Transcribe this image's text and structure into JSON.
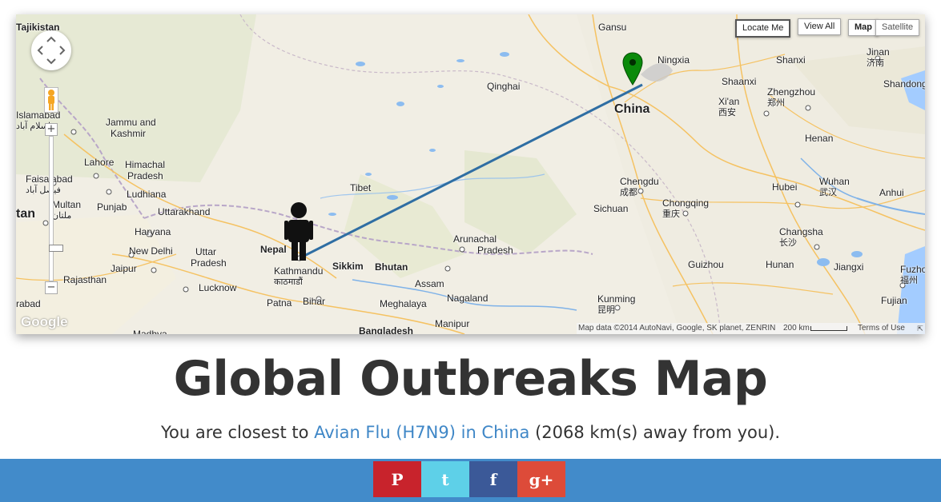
{
  "map": {
    "controls": {
      "locate_me": "Locate Me",
      "view_all": "View All",
      "map_type": "Map",
      "satellite_type": "Satellite",
      "zoom_in": "+",
      "zoom_out": "−"
    },
    "attribution": "Map data ©2014 AutoNavi, Google, SK planet, ZENRIN",
    "scale": "200 km",
    "terms": "Terms of Use",
    "logo": "Google",
    "user_icon": "person-marker-icon",
    "outbreak_icon": "green-pin-icon",
    "line_color": "#2f6ea3",
    "places": [
      {
        "name": "Tajikistan",
        "zh": ""
      },
      {
        "name": "Gansu",
        "zh": ""
      },
      {
        "name": "Ningxia",
        "zh": ""
      },
      {
        "name": "Shanxi",
        "zh": ""
      },
      {
        "name": "Jinan",
        "zh": "济南"
      },
      {
        "name": "Shandong",
        "zh": ""
      },
      {
        "name": "Qinghai",
        "zh": ""
      },
      {
        "name": "Shaanxi",
        "zh": ""
      },
      {
        "name": "Zhengzhou",
        "zh": "郑州"
      },
      {
        "name": "Xi'an",
        "zh": "西安"
      },
      {
        "name": "China",
        "zh": ""
      },
      {
        "name": "Islamabad",
        "zh": "اسلام آباد"
      },
      {
        "name": "Jammu and",
        "zh": ""
      },
      {
        "name": "Kashmir",
        "zh": ""
      },
      {
        "name": "Henan",
        "zh": ""
      },
      {
        "name": "Lahore",
        "zh": ""
      },
      {
        "name": "Himachal",
        "zh": ""
      },
      {
        "name": "Pradesh",
        "zh": ""
      },
      {
        "name": "Faisalabad",
        "zh": "فیصل آباد"
      },
      {
        "name": "Tibet",
        "zh": ""
      },
      {
        "name": "Chengdu",
        "zh": "成都"
      },
      {
        "name": "Hubei",
        "zh": ""
      },
      {
        "name": "Wuhan",
        "zh": "武汉"
      },
      {
        "name": "Anhui",
        "zh": ""
      },
      {
        "name": "Ludhiana",
        "zh": ""
      },
      {
        "name": "Chongqing",
        "zh": "重庆"
      },
      {
        "name": "Multan",
        "zh": "ملتان"
      },
      {
        "name": "Punjab",
        "zh": ""
      },
      {
        "name": "Sichuan",
        "zh": ""
      },
      {
        "name": "tan",
        "zh": ""
      },
      {
        "name": "Uttarakhand",
        "zh": ""
      },
      {
        "name": "Haryana",
        "zh": ""
      },
      {
        "name": "Arunachal",
        "zh": ""
      },
      {
        "name": "Pradesh",
        "zh": ""
      },
      {
        "name": "Changsha",
        "zh": "长沙"
      },
      {
        "name": "New Delhi",
        "zh": ""
      },
      {
        "name": "Uttar",
        "zh": ""
      },
      {
        "name": "Pradesh",
        "zh": ""
      },
      {
        "name": "Nepal",
        "zh": ""
      },
      {
        "name": "Jaipur",
        "zh": ""
      },
      {
        "name": "Kathmandu",
        "zh": "काठमाडौं"
      },
      {
        "name": "Sikkim",
        "zh": ""
      },
      {
        "name": "Bhutan",
        "zh": ""
      },
      {
        "name": "Guizhou",
        "zh": ""
      },
      {
        "name": "Hunan",
        "zh": ""
      },
      {
        "name": "Jiangxi",
        "zh": ""
      },
      {
        "name": "Fuzhou",
        "zh": "福州"
      },
      {
        "name": "Rajasthan",
        "zh": ""
      },
      {
        "name": "Lucknow",
        "zh": ""
      },
      {
        "name": "Assam",
        "zh": ""
      },
      {
        "name": "Nagaland",
        "zh": ""
      },
      {
        "name": "Kunming",
        "zh": "昆明"
      },
      {
        "name": "Patna",
        "zh": ""
      },
      {
        "name": "Bihar",
        "zh": ""
      },
      {
        "name": "Meghalaya",
        "zh": ""
      },
      {
        "name": "Fujian",
        "zh": ""
      },
      {
        "name": "rabad",
        "zh": ""
      },
      {
        "name": "Manipur",
        "zh": ""
      },
      {
        "name": "Bangladesh",
        "zh": ""
      },
      {
        "name": "Madhya",
        "zh": ""
      }
    ]
  },
  "page": {
    "title": "Global Outbreaks Map",
    "closest_prefix": "You are closest to ",
    "outbreak_link": "Avian Flu (H7N9) in China",
    "closest_suffix": " (2068 km(s) away from you)."
  },
  "share": {
    "pinterest": "P",
    "twitter": "t",
    "facebook": "f",
    "gplus": "g+"
  }
}
